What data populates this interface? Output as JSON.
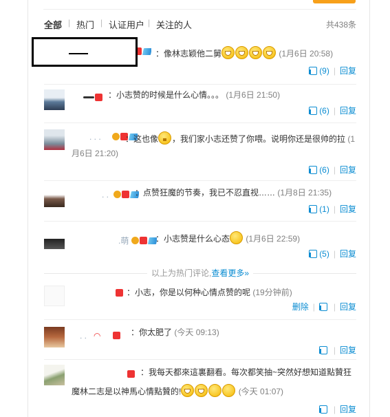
{
  "filters": {
    "all": "全部",
    "hot": "热门",
    "verified": "认证用户",
    "following": "关注的人",
    "total": "共438条"
  },
  "comments": [
    {
      "text": "：像林志颖他二舅",
      "time": "(1月6日 20:58)",
      "like": "(9)",
      "reply": "回复",
      "emoji_count": 4
    },
    {
      "text": "：小志赞的时候是什么心情。。。",
      "time": "(1月6日 21:50)",
      "like": "(6)",
      "reply": "回复"
    },
    {
      "text_a": "：这也像",
      "text_b": "，我们家小志还赞了你喂。说明你还是很帅的拉",
      "time_a": "(1",
      "time_b": "月6日 21:20)",
      "like": "(6)",
      "reply": "回复"
    },
    {
      "text": "：点赞狂魔的节奏，我已不忍直视……",
      "time": "(1月8日 21:35)",
      "like": "(1)",
      "reply": "回复"
    },
    {
      "text": "：小志赞是什么心态",
      "time": "(1月6日 22:59)",
      "like": "(5)",
      "reply": "回复"
    },
    {
      "text": "：小志，你是以何种心情点赞的呢",
      "time": "(19分钟前)",
      "delete": "删除",
      "reply": "回复"
    },
    {
      "text": "：你太肥了",
      "time": "(今天 09:13)",
      "reply": "回复"
    },
    {
      "text_a": "：我每天都來這裏翻看。每次都笑抽~突然好想知道點贊狂",
      "text_b": "魔林二志是以神馬心情點贊的!",
      "time": "(今天 01:07)",
      "reply": "回复"
    }
  ],
  "hot_divider": {
    "text": "以上为热门评论,",
    "link": "查看更多»"
  },
  "colors": {
    "link": "#0a8cd2",
    "accent": "#f7a01a"
  }
}
